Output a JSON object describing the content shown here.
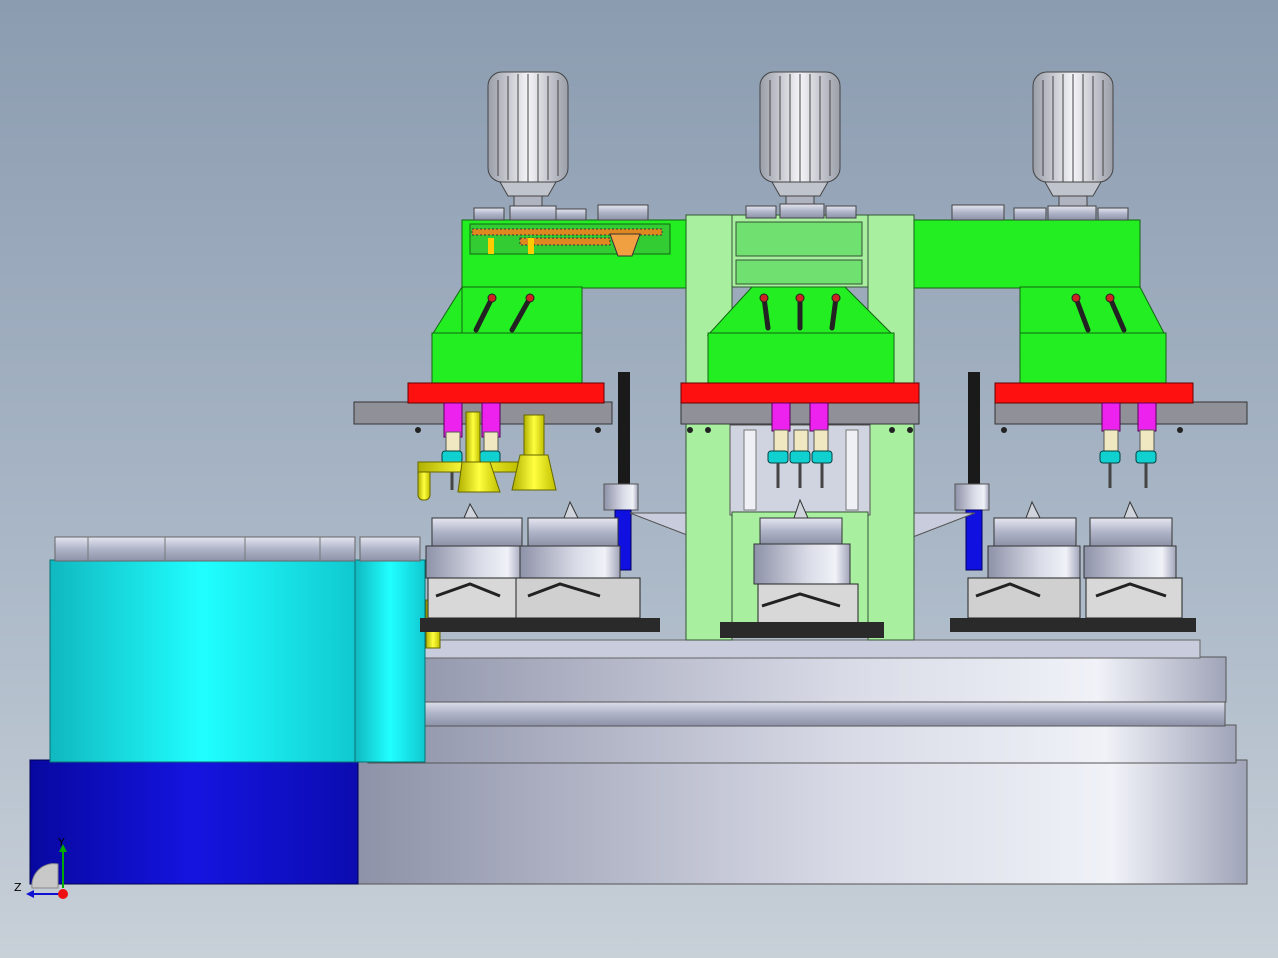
{
  "viewport": {
    "background_top": "#8c9cb0",
    "background_bottom": "#c8d0d8"
  },
  "colors": {
    "frame_green": "#22ee22",
    "frame_green_dark": "#117711",
    "light_green": "#a8f0a0",
    "red_plate": "#ff1010",
    "magenta_spindle": "#ee22ee",
    "cyan_nut": "#10d0d0",
    "yellow_fixture": "#f0f020",
    "cyan_drum": "#10f0f0",
    "blue_base": "#1010d0",
    "steel": "#b4b8cc",
    "dark_steel": "#2a2a2a",
    "gear_orange": "#e08820"
  },
  "triad": {
    "y_label": "Y",
    "z_label": "Z"
  }
}
